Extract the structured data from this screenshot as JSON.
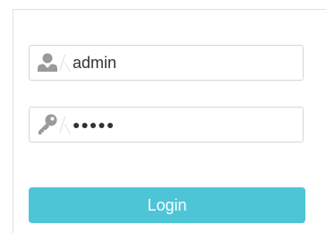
{
  "login_form": {
    "username": {
      "icon": "user-icon",
      "value": "admin"
    },
    "password": {
      "icon": "key-icon",
      "value": "●●●●●"
    },
    "login_label": "Login",
    "colors": {
      "button": "#4dc5d7",
      "icon": "#9a9a9a",
      "border": "#d6d6d6"
    }
  }
}
